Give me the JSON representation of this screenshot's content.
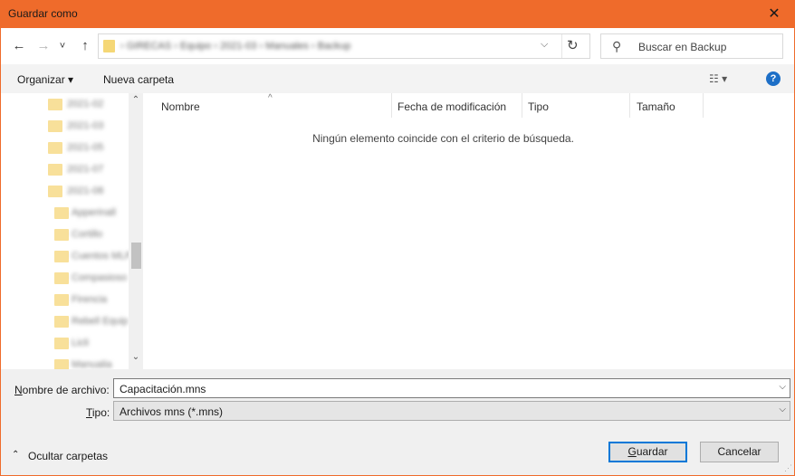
{
  "window": {
    "title": "Guardar como",
    "close_glyph": "✕",
    "accent_color": "#ef6b2b"
  },
  "nav": {
    "back_glyph": "←",
    "forward_glyph": "→",
    "recent_glyph": "˅",
    "up_glyph": "↑",
    "breadcrumb": "› GIRECAS › Equipo › 2021-03 › Manuales › Backup",
    "address_dropdown_glyph": "⌵",
    "refresh_glyph": "↻",
    "search_placeholder": "Buscar en Backup",
    "search_glyph": "⚲"
  },
  "toolbar": {
    "organize": "Organizar ▾",
    "new_folder": "Nueva carpeta",
    "views_glyph": "☷ ▾",
    "help_glyph": "?"
  },
  "nav_pane": {
    "items": [
      {
        "label": "2021-02"
      },
      {
        "label": "2021-03"
      },
      {
        "label": "2021-05"
      },
      {
        "label": "2021-07"
      },
      {
        "label": "2021-08"
      },
      {
        "label": "Apperinall"
      },
      {
        "label": "Cortillo"
      },
      {
        "label": "Cuentos MLP"
      },
      {
        "label": "Compasioso"
      },
      {
        "label": "Firencia"
      },
      {
        "label": "Rebell Equip"
      },
      {
        "label": "Licli"
      },
      {
        "label": "Manualia"
      }
    ],
    "scroll_up": "⌃",
    "scroll_down": "⌄"
  },
  "file_list": {
    "columns": [
      "Nombre",
      "Fecha de modificación",
      "Tipo",
      "Tamaño"
    ],
    "sort_indicator": "^",
    "empty_message": "Ningún elemento coincide con el criterio de búsqueda."
  },
  "form": {
    "filename_label_pre": "N",
    "filename_label_rest": "ombre de archivo:",
    "filename_value": "Capacitación.mns",
    "type_label_pre": "T",
    "type_label_rest": "ipo:",
    "type_value": "Archivos mns (*.mns)",
    "chevron": "⌵"
  },
  "footer": {
    "hide_folders_glyph": "⌃",
    "hide_folders": "Ocultar carpetas",
    "save_pre": "G",
    "save_rest": "uardar",
    "cancel": "Cancelar",
    "grip": "⋰"
  }
}
